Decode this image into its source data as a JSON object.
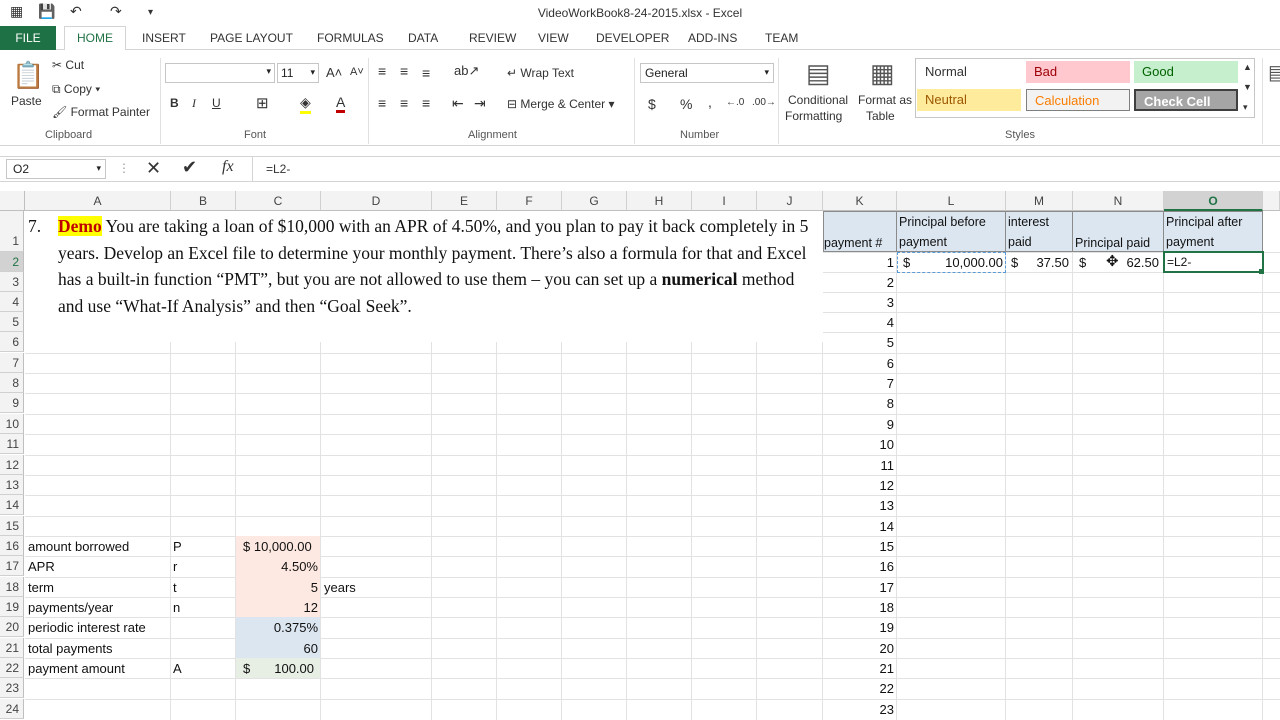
{
  "window": {
    "title": "VideoWorkBook8-24-2015.xlsx - Excel"
  },
  "tabs": [
    "FILE",
    "HOME",
    "INSERT",
    "PAGE LAYOUT",
    "FORMULAS",
    "DATA",
    "REVIEW",
    "VIEW",
    "DEVELOPER",
    "ADD-INS",
    "TEAM"
  ],
  "ribbon": {
    "clipboard": {
      "paste": "Paste",
      "cut": "Cut",
      "copy": "Copy",
      "format_painter": "Format Painter",
      "label": "Clipboard"
    },
    "font": {
      "size": "11",
      "label": "Font",
      "bold": "B",
      "italic": "I",
      "underline": "U"
    },
    "alignment": {
      "wrap": "Wrap Text",
      "merge": "Merge & Center",
      "label": "Alignment"
    },
    "number": {
      "format": "General",
      "currency": "$",
      "percent": "%",
      "comma": ",",
      "label": "Number"
    },
    "styles": {
      "conditional": "Conditional",
      "formatting": "Formatting",
      "format_as": "Format as",
      "table": "Table",
      "normal": "Normal",
      "bad": "Bad",
      "good": "Good",
      "neutral": "Neutral",
      "calculation": "Calculation",
      "check_cell": "Check Cell",
      "label": "Styles"
    }
  },
  "formula_bar": {
    "name_box": "O2",
    "fx": "fx",
    "formula": "=L2-"
  },
  "columns": [
    "A",
    "B",
    "C",
    "D",
    "E",
    "F",
    "G",
    "H",
    "I",
    "J",
    "K",
    "L",
    "M",
    "N",
    "O"
  ],
  "rows": [
    "1",
    "2",
    "3",
    "4",
    "5",
    "6",
    "7",
    "8",
    "9",
    "10",
    "11",
    "12",
    "13",
    "14",
    "15",
    "16",
    "17",
    "18",
    "19",
    "20",
    "21",
    "22",
    "23",
    "24"
  ],
  "problem": {
    "number": "7.",
    "demo": "Demo",
    "text1": " You are taking a loan of $10,000 with an APR of 4.50%, and you plan to pay it back completely in 5 years. Develop an Excel file to determine your monthly payment. There’s also a formula for that and Excel has a built-in function “PMT”, but you are not allowed to use them – you can set up a ",
    "bold": "numerical",
    "text2": " method and use “What-If Analysis” and then “Goal Seek”."
  },
  "inputs": [
    {
      "label": "amount borrowed",
      "sym": "P",
      "value": "$ 10,000.00",
      "unit": ""
    },
    {
      "label": "APR",
      "sym": "r",
      "value": "4.50%",
      "unit": ""
    },
    {
      "label": "term",
      "sym": "t",
      "value": "5",
      "unit": "years"
    },
    {
      "label": "payments/year",
      "sym": "n",
      "value": "12",
      "unit": ""
    },
    {
      "label": "periodic interest rate",
      "sym": "",
      "value": "0.375%",
      "unit": ""
    },
    {
      "label": "total payments",
      "sym": "",
      "value": "60",
      "unit": ""
    },
    {
      "label": "payment amount",
      "sym": "A",
      "dollar": "$",
      "value": "100.00",
      "unit": ""
    }
  ],
  "table": {
    "headers": {
      "k": "payment #",
      "l1": "Principal before",
      "l2": "payment",
      "m1": "interest",
      "m2": "paid",
      "n": "Principal paid",
      "o1": "Principal after",
      "o2": "payment"
    },
    "row2": {
      "dollar": "$",
      "l": "10,000.00",
      "m": "37.50",
      "n": "62.50",
      "o": "=L2-"
    },
    "payment_numbers": [
      "1",
      "2",
      "3",
      "4",
      "5",
      "6",
      "7",
      "8",
      "9",
      "10",
      "11",
      "12",
      "13",
      "14",
      "15",
      "16",
      "17",
      "18",
      "19",
      "20",
      "21",
      "22",
      "23"
    ]
  },
  "colors": {
    "accent": "#217346",
    "file_tab": "#1e7145",
    "input_fill": "#fde9e1",
    "calc_fill": "#dce6f1",
    "header_fill": "#dce6f1"
  }
}
